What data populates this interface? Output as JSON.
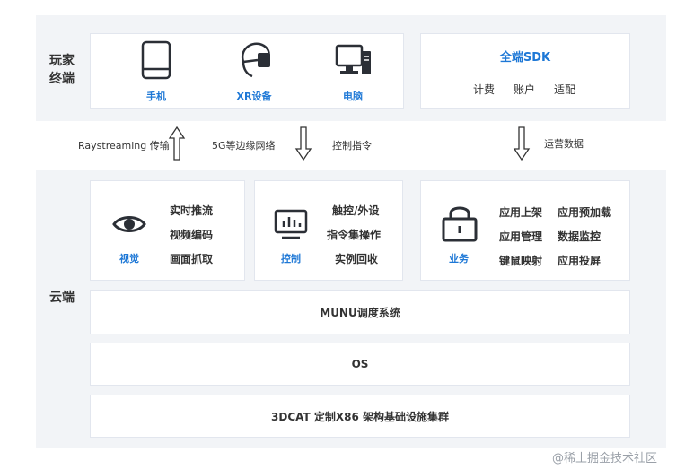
{
  "top": {
    "section_label": "玩家\n终端",
    "devices": [
      {
        "label": "手机",
        "icon": "phone-icon"
      },
      {
        "label": "XR设备",
        "icon": "vr-headset-icon"
      },
      {
        "label": "电脑",
        "icon": "desktop-computer-icon"
      }
    ],
    "sdk": {
      "title": "全端SDK",
      "items": [
        "计费",
        "账户",
        "适配"
      ]
    }
  },
  "flows": {
    "up_left_label": "Raystreaming 传输",
    "middle_label": "5G等边缘网络",
    "down_middle_label": "控制指令",
    "down_right_label": "运营数据"
  },
  "cloud": {
    "section_label": "云端",
    "modules": [
      {
        "label": "视觉",
        "icon": "eye-icon",
        "items": [
          "实时推流",
          "视频编码",
          "画面抓取"
        ]
      },
      {
        "label": "控制",
        "icon": "monitor-chart-icon",
        "items": [
          "触控/外设",
          "指令集操作",
          "实例回收"
        ]
      },
      {
        "label": "业务",
        "icon": "lock-icon",
        "items": [
          "应用上架",
          "应用预加载",
          "应用管理",
          "数据监控",
          "键鼠映射",
          "应用投屏"
        ]
      }
    ],
    "layers": [
      "MUNU调度系统",
      "OS",
      "3DCAT 定制X86 架构基础设施集群"
    ]
  },
  "watermark": "@稀土掘金技术社区",
  "colors": {
    "accent_blue": "#1e78d6",
    "icon_dark": "#2b2f36",
    "panel_bg": "#f2f4f7"
  }
}
